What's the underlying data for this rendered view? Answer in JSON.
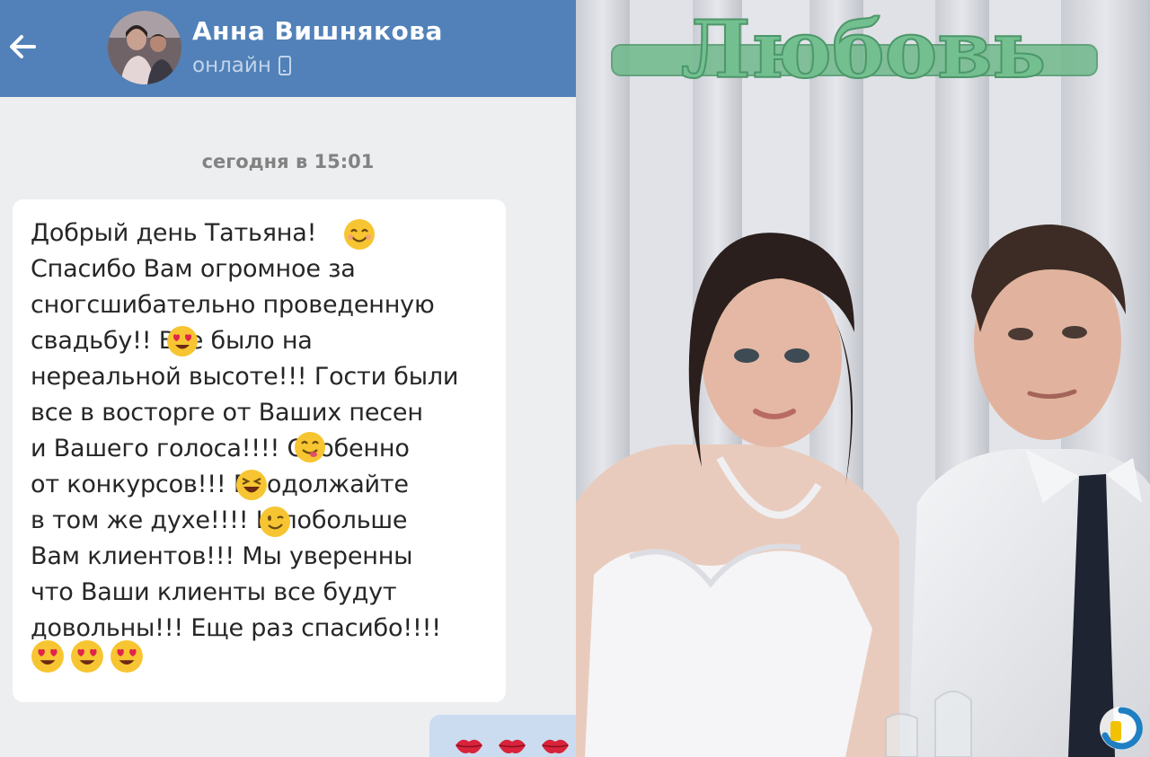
{
  "header": {
    "contact_name": "Анна Вишнякова",
    "status": "онлайн",
    "back_icon": "arrow-left-icon",
    "status_icon": "mobile-phone-icon",
    "bg_color": "#5181b8"
  },
  "conversation": {
    "date_separator": "сегодня в 15:01",
    "incoming_message": {
      "lines": [
        "Добрый день Татьяна! 😊",
        "Спасибо Вам огромное за",
        "сногсшибательно проведенную",
        "свадьбу!! 😍 Все было на",
        "нереальной высоте!!! Гости были",
        "все в восторге от Ваших песен",
        "и Вашего голоса!!!! 😋 Особенно",
        "от конкурсов!!! 😆 Продолжайте",
        "в том же духе!!!! 😉 И побольше",
        "Вам клиентов!!! Мы уверенны",
        "что Ваши клиенты все будут",
        "довольны!!! Еще раз спасибо!!!!"
      ],
      "text": "Добрый день Татьяна!\nСпасибо Вам огромное за\nсногсшибательно проведенную\nсвадьбу!!       Все было на\nнереальной высоте!!! Гости были\nвсе в восторге от Ваших песен\nи Вашего голоса!!!!       Особенно\nот конкурсов!!!       Продолжайте\nв том же духе!!!!       И побольше\nВам клиентов!!! Мы уверенны\nчто Ваши клиенты все будут\nдовольны!!! Еще раз спасибо!!!!",
      "trailing_emoji": [
        "heart-eyes-emoji",
        "heart-eyes-emoji",
        "heart-eyes-emoji"
      ]
    },
    "outgoing_message": {
      "emoji": [
        "kiss-lips-emoji",
        "kiss-lips-emoji",
        "kiss-lips-emoji"
      ]
    }
  },
  "photo": {
    "sign_text": "Любовь",
    "description_icon": "wedding-photo",
    "watermark_icon": "site-logo-icon"
  }
}
